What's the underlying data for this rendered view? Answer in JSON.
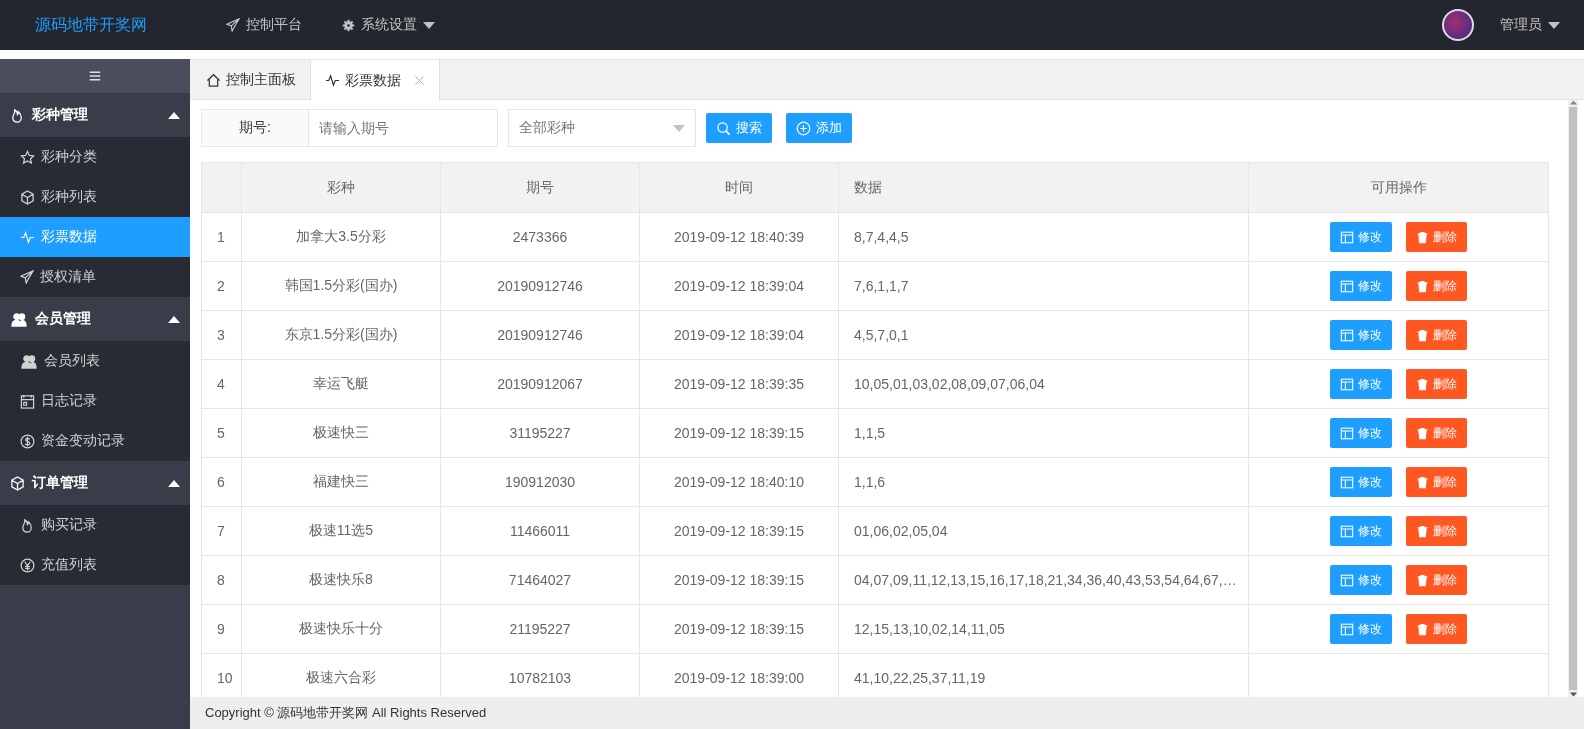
{
  "header": {
    "logo": "源码地带开奖网",
    "nav": [
      {
        "label": "控制平台",
        "dropdown": false
      },
      {
        "label": "系统设置",
        "dropdown": true
      }
    ],
    "user": {
      "name": "管理员",
      "dropdown": true
    }
  },
  "sidebar": {
    "groups": [
      {
        "label": "彩种管理",
        "expanded": true,
        "items": [
          {
            "label": "彩种分类",
            "selected": false
          },
          {
            "label": "彩种列表",
            "selected": false
          },
          {
            "label": "彩票数据",
            "selected": true
          },
          {
            "label": "授权清单",
            "selected": false
          }
        ]
      },
      {
        "label": "会员管理",
        "expanded": true,
        "items": [
          {
            "label": "会员列表",
            "selected": false
          },
          {
            "label": "日志记录",
            "selected": false
          },
          {
            "label": "资金变动记录",
            "selected": false
          }
        ]
      },
      {
        "label": "订单管理",
        "expanded": true,
        "items": [
          {
            "label": "购买记录",
            "selected": false
          },
          {
            "label": "充值列表",
            "selected": false
          }
        ]
      }
    ]
  },
  "tabs": [
    {
      "label": "控制主面板",
      "selected": false,
      "closable": false
    },
    {
      "label": "彩票数据",
      "selected": true,
      "closable": true
    }
  ],
  "filter": {
    "label": "期号:",
    "placeholder": "请输入期号",
    "select": "全部彩种",
    "buttons": [
      {
        "label": "搜索",
        "kind": "search"
      },
      {
        "label": "添加",
        "kind": "add"
      }
    ]
  },
  "table": {
    "columns": [
      "彩种",
      "期号",
      "时间",
      "数据",
      "可用操作"
    ],
    "rows": [
      {
        "index": "1",
        "lottery": "加拿大3.5分彩",
        "issue": "2473366",
        "time": "2019-09-12 18:40:39",
        "data": "8,7,4,4,5",
        "actions": [
          {
            "label": "修改",
            "kind": "edit"
          },
          {
            "label": "删除",
            "kind": "delete"
          }
        ]
      },
      {
        "index": "2",
        "lottery": "韩国1.5分彩(国办)",
        "issue": "20190912746",
        "time": "2019-09-12 18:39:04",
        "data": "7,6,1,1,7",
        "actions": [
          {
            "label": "修改",
            "kind": "edit"
          },
          {
            "label": "删除",
            "kind": "delete"
          }
        ]
      },
      {
        "index": "3",
        "lottery": "东京1.5分彩(国办)",
        "issue": "20190912746",
        "time": "2019-09-12 18:39:04",
        "data": "4,5,7,0,1",
        "actions": [
          {
            "label": "修改",
            "kind": "edit"
          },
          {
            "label": "删除",
            "kind": "delete"
          }
        ]
      },
      {
        "index": "4",
        "lottery": "幸运飞艇",
        "issue": "20190912067",
        "time": "2019-09-12 18:39:35",
        "data": "10,05,01,03,02,08,09,07,06,04",
        "actions": [
          {
            "label": "修改",
            "kind": "edit"
          },
          {
            "label": "删除",
            "kind": "delete"
          }
        ]
      },
      {
        "index": "5",
        "lottery": "极速快三",
        "issue": "31195227",
        "time": "2019-09-12 18:39:15",
        "data": "1,1,5",
        "actions": [
          {
            "label": "修改",
            "kind": "edit"
          },
          {
            "label": "删除",
            "kind": "delete"
          }
        ]
      },
      {
        "index": "6",
        "lottery": "福建快三",
        "issue": "190912030",
        "time": "2019-09-12 18:40:10",
        "data": "1,1,6",
        "actions": [
          {
            "label": "修改",
            "kind": "edit"
          },
          {
            "label": "删除",
            "kind": "delete"
          }
        ]
      },
      {
        "index": "7",
        "lottery": "极速11选5",
        "issue": "11466011",
        "time": "2019-09-12 18:39:15",
        "data": "01,06,02,05,04",
        "actions": [
          {
            "label": "修改",
            "kind": "edit"
          },
          {
            "label": "删除",
            "kind": "delete"
          }
        ]
      },
      {
        "index": "8",
        "lottery": "极速快乐8",
        "issue": "71464027",
        "time": "2019-09-12 18:39:15",
        "data": "04,07,09,11,12,13,15,16,17,18,21,34,36,40,43,53,54,64,67,…",
        "actions": [
          {
            "label": "修改",
            "kind": "edit"
          },
          {
            "label": "删除",
            "kind": "delete"
          }
        ]
      },
      {
        "index": "9",
        "lottery": "极速快乐十分",
        "issue": "21195227",
        "time": "2019-09-12 18:39:15",
        "data": "12,15,13,10,02,14,11,05",
        "actions": [
          {
            "label": "修改",
            "kind": "edit"
          },
          {
            "label": "删除",
            "kind": "delete"
          }
        ]
      },
      {
        "index": "10",
        "lottery": "极速六合彩",
        "issue": "10782103",
        "time": "2019-09-12 18:39:00",
        "data": "41,10,22,25,37,11,19"
      }
    ]
  },
  "footer": "Copyright © 源码地带开奖网 All Rights Reserved"
}
